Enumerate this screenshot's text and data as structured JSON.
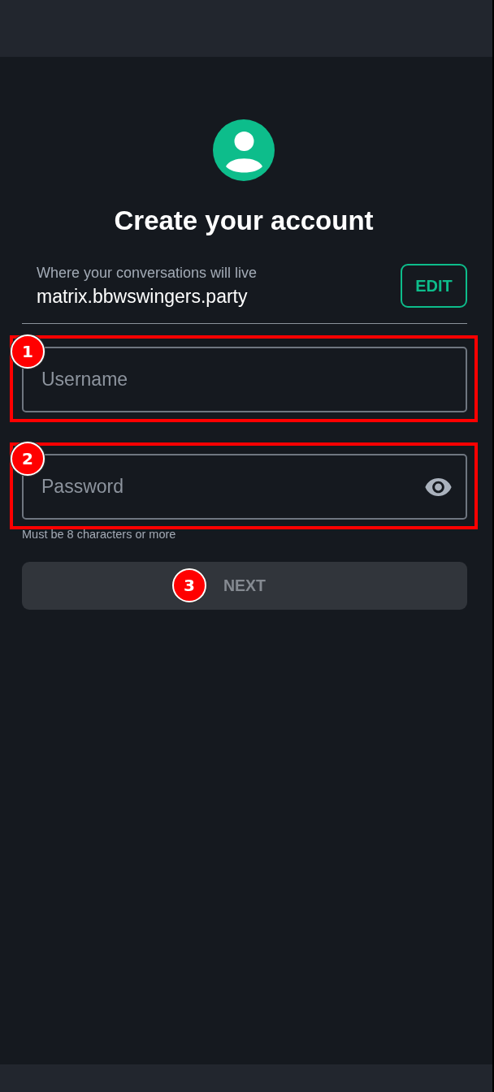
{
  "header": {
    "title": "Create your account"
  },
  "server": {
    "label": "Where your conversations will live",
    "value": "matrix.bbwswingers.party",
    "edit_button": "EDIT"
  },
  "fields": [
    {
      "kind": "username",
      "placeholder": "Username",
      "marker": {
        "label": "1",
        "framed": true
      }
    },
    {
      "kind": "password",
      "placeholder": "Password",
      "hint": "Must be 8 characters or more",
      "marker": {
        "label": "2",
        "framed": true
      }
    }
  ],
  "next_button": {
    "label": "NEXT",
    "disabled": true,
    "marker": {
      "label": "3"
    }
  }
}
